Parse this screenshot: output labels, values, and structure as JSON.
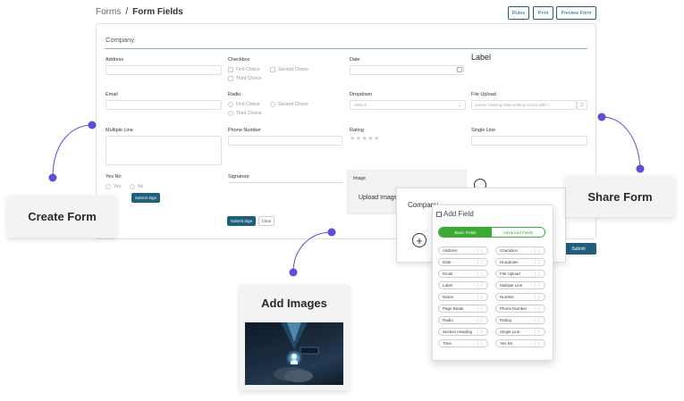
{
  "breadcrumb": {
    "root": "Forms",
    "separator": "/",
    "current": "Form Fields"
  },
  "toolbar": {
    "rules": "Rules",
    "print": "Print",
    "preview": "Preview Form"
  },
  "form": {
    "title": "Company",
    "fields": {
      "address": "Address",
      "checkbox": "Checkbox",
      "checkbox_options": [
        "First Choice",
        "Second Choice",
        "Third Choice"
      ],
      "date": "Date",
      "label": "Label",
      "email": "Email",
      "radio": "Radio",
      "radio_options": [
        "First Choice",
        "Second Choice",
        "Third Choice"
      ],
      "dropdown": "Dropdown",
      "dropdown_value": "-Select-",
      "file_upload": "File Upload",
      "file_upload_value": "pointer-viewing-main-setting-cursor-with->",
      "multiple_line": "Multiple Line",
      "phone_number": "Phone Number",
      "rating": "Rating",
      "rating_stars": "★★★★★",
      "single_line": "Single Line",
      "yes_no": "Yes No",
      "yes": "Yes",
      "no": "No",
      "signature": "Signature",
      "submit_sign": "Submit Sign",
      "clear": "Clear"
    },
    "submit": "Submit"
  },
  "image_panel": {
    "title": "Image",
    "upload": "Upload Image"
  },
  "company_panel": {
    "title": "Company",
    "plus": "+"
  },
  "add_field": {
    "title": "Add Field",
    "tabs": {
      "basic": "Basic Fields",
      "advanced": "Advanced Fields"
    },
    "items": [
      "Address",
      "Checkbox",
      "Date",
      "Dropdown",
      "Email",
      "File Upload",
      "Label",
      "Multiple Line",
      "Name",
      "Number",
      "Page Break",
      "Phone Number",
      "Radio",
      "Rating",
      "Section Heading",
      "Single Line",
      "Time",
      "Yes No"
    ]
  },
  "callouts": {
    "create_form": "Create Form",
    "share_form": "Share Form",
    "add_images": "Add Images"
  },
  "colors": {
    "accent": "#1f5f7a",
    "green": "#3aaa35",
    "connector": "#5b4fd6"
  }
}
